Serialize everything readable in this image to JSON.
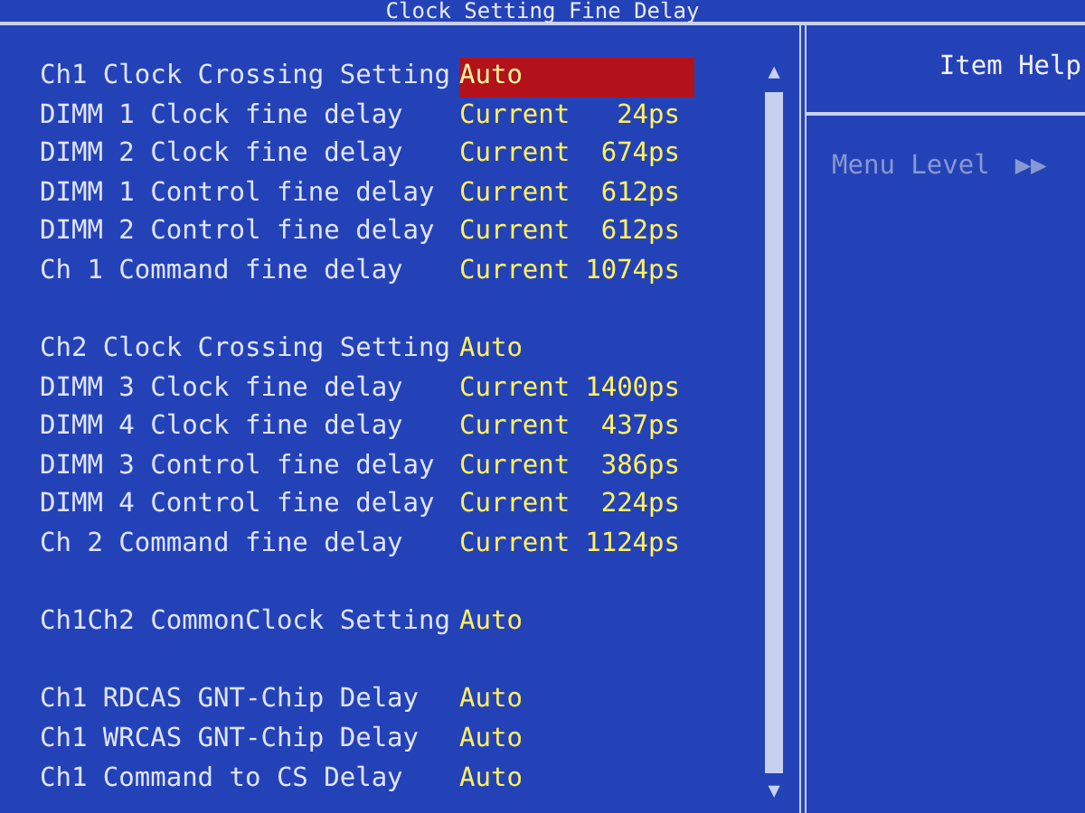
{
  "window": {
    "title": "Clock Setting Fine Delay"
  },
  "groups": [
    {
      "rows": [
        {
          "label": "Ch1 Clock Crossing Setting",
          "value": "Auto",
          "selected": true
        },
        {
          "label": "DIMM 1 Clock fine delay",
          "value": "Current",
          "reading": "24ps",
          "selected": false
        },
        {
          "label": "DIMM 2 Clock fine delay",
          "value": "Current",
          "reading": "674ps",
          "selected": false
        },
        {
          "label": "DIMM 1 Control fine delay",
          "value": "Current",
          "reading": "612ps",
          "selected": false
        },
        {
          "label": "DIMM 2 Control fine delay",
          "value": "Current",
          "reading": "612ps",
          "selected": false
        },
        {
          "label": "Ch 1 Command fine delay",
          "value": "Current",
          "reading": "1074ps",
          "selected": false
        }
      ]
    },
    {
      "rows": [
        {
          "label": "Ch2 Clock Crossing Setting",
          "value": "Auto",
          "selected": false
        },
        {
          "label": "DIMM 3 Clock fine delay",
          "value": "Current",
          "reading": "1400ps",
          "selected": false
        },
        {
          "label": "DIMM 4 Clock fine delay",
          "value": "Current",
          "reading": "437ps",
          "selected": false
        },
        {
          "label": "DIMM 3 Control fine delay",
          "value": "Current",
          "reading": "386ps",
          "selected": false
        },
        {
          "label": "DIMM 4 Control fine delay",
          "value": "Current",
          "reading": "224ps",
          "selected": false
        },
        {
          "label": "Ch 2 Command fine delay",
          "value": "Current",
          "reading": "1124ps",
          "selected": false
        }
      ]
    },
    {
      "rows": [
        {
          "label": "Ch1Ch2 CommonClock Setting",
          "value": "Auto",
          "selected": false
        }
      ]
    },
    {
      "rows": [
        {
          "label": "Ch1 RDCAS GNT-Chip Delay",
          "value": "Auto",
          "selected": false
        },
        {
          "label": "Ch1 WRCAS GNT-Chip Delay",
          "value": "Auto",
          "selected": false
        },
        {
          "label": "Ch1 Command to CS Delay",
          "value": "Auto",
          "selected": false
        }
      ]
    }
  ],
  "scrollbar": {
    "up": "▲",
    "down": "▼"
  },
  "help": {
    "title": "Item Help",
    "menu_level_label": "Menu Level",
    "menu_level_value": "▶▶"
  }
}
